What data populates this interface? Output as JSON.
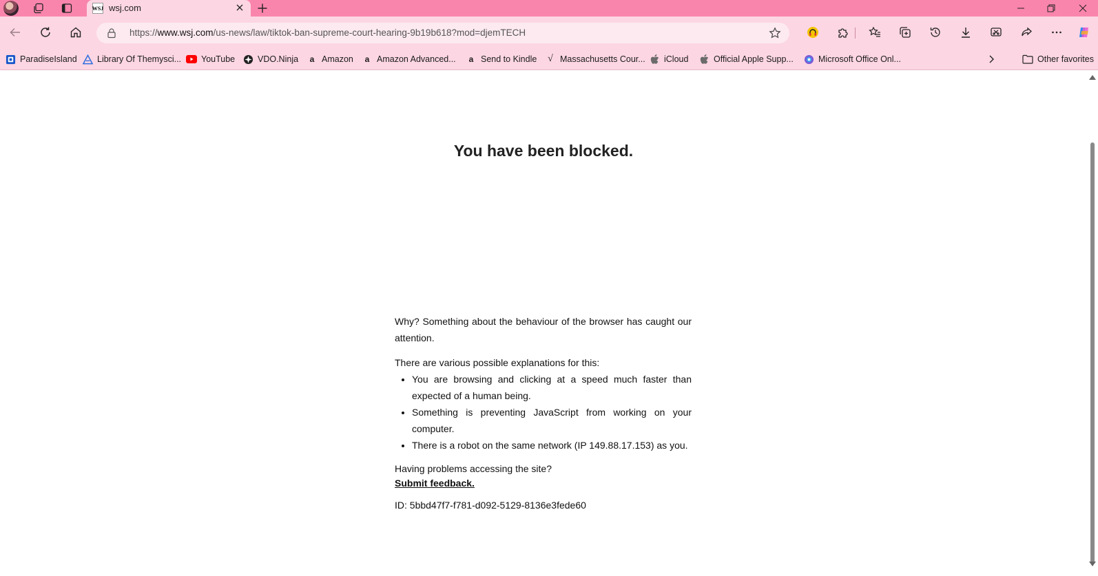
{
  "tab": {
    "title": "wsj.com",
    "favicon_text": "WSJ"
  },
  "address": {
    "prefix": "https://",
    "host": "www.wsj.com",
    "path": "/us-news/law/tiktok-ban-supreme-court-hearing-9b19b618?mod=djemTECH"
  },
  "favorites": [
    {
      "label": "ParadiseIsland",
      "icon": "bookmark-square-icon",
      "color": "#1a57c9"
    },
    {
      "label": "Library Of Themysci...",
      "icon": "triangle-logo-icon",
      "color": "#2b6de0"
    },
    {
      "label": "YouTube",
      "icon": "youtube-icon",
      "color": "#ff0000"
    },
    {
      "label": "VDO.Ninja",
      "icon": "ninja-star-icon",
      "color": "#222222"
    },
    {
      "label": "Amazon",
      "icon": "amazon-icon",
      "color": "#111111"
    },
    {
      "label": "Amazon Advanced...",
      "icon": "amazon-icon",
      "color": "#111111"
    },
    {
      "label": "Send to Kindle",
      "icon": "amazon-icon",
      "color": "#111111"
    },
    {
      "label": "Massachusetts Cour...",
      "icon": "checkmark-logo-icon",
      "color": "#111111"
    },
    {
      "label": "iCloud",
      "icon": "apple-icon",
      "color": "#6b6b6b"
    },
    {
      "label": "Official Apple Supp...",
      "icon": "apple-icon",
      "color": "#6b6b6b"
    },
    {
      "label": "Microsoft Office Onl...",
      "icon": "office-icon",
      "color": "#7b5cd6"
    }
  ],
  "other_favorites": "Other favorites",
  "content": {
    "heading": "You have been blocked.",
    "why": "Why? Something about the behaviour of the browser has caught our attention.",
    "explanations_intro": "There are various possible explanations for this:",
    "explanations": [
      "You are browsing and clicking at a speed much faster than expected of a human being.",
      "Something is preventing JavaScript from working on your computer.",
      "There is a robot on the same network (IP 149.88.17.153) as you."
    ],
    "problems": "Having problems accessing the site?",
    "feedback_link": "Submit feedback.",
    "id_line": "ID: 5bbd47f7-f781-d092-5129-8136e3fede60"
  },
  "colors": {
    "titlebar": "#fa85ac",
    "toolbar": "#fcd6e3",
    "addressbar": "#fdeaf1"
  }
}
